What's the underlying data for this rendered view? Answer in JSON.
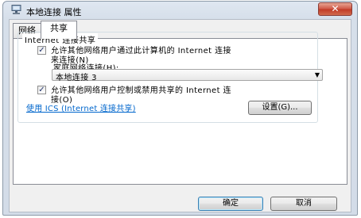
{
  "window": {
    "title": "本地连接 属性",
    "close_symbol": "✕",
    "icon": "network-adapter-icon"
  },
  "tabs": [
    {
      "label": "网络",
      "active": false
    },
    {
      "label": "共享",
      "active": true
    }
  ],
  "group": {
    "title": "Internet 连接共享"
  },
  "options": {
    "allow_share": {
      "checked": true,
      "line1": "允许其他网络用户通过此计算机的 Internet 连接",
      "line2": "来连接(N)"
    },
    "home_network_label": "家庭网络连接(H):",
    "home_network_value": "本地连接 3",
    "allow_control": {
      "checked": true,
      "line1": "允许其他网络用户控制或禁用共享的 Internet 连",
      "line2": "接(O)"
    }
  },
  "link_text": "使用 ICS (Internet 连接共享)",
  "settings_button": "设置(G)...",
  "ok_button": "确定",
  "cancel_button": "取消",
  "check_mark": "✓",
  "dropdown_arrow": "▼",
  "colors": {
    "link": "#0066cc",
    "close_button": "#c13a25",
    "checkmark": "#24366e"
  }
}
